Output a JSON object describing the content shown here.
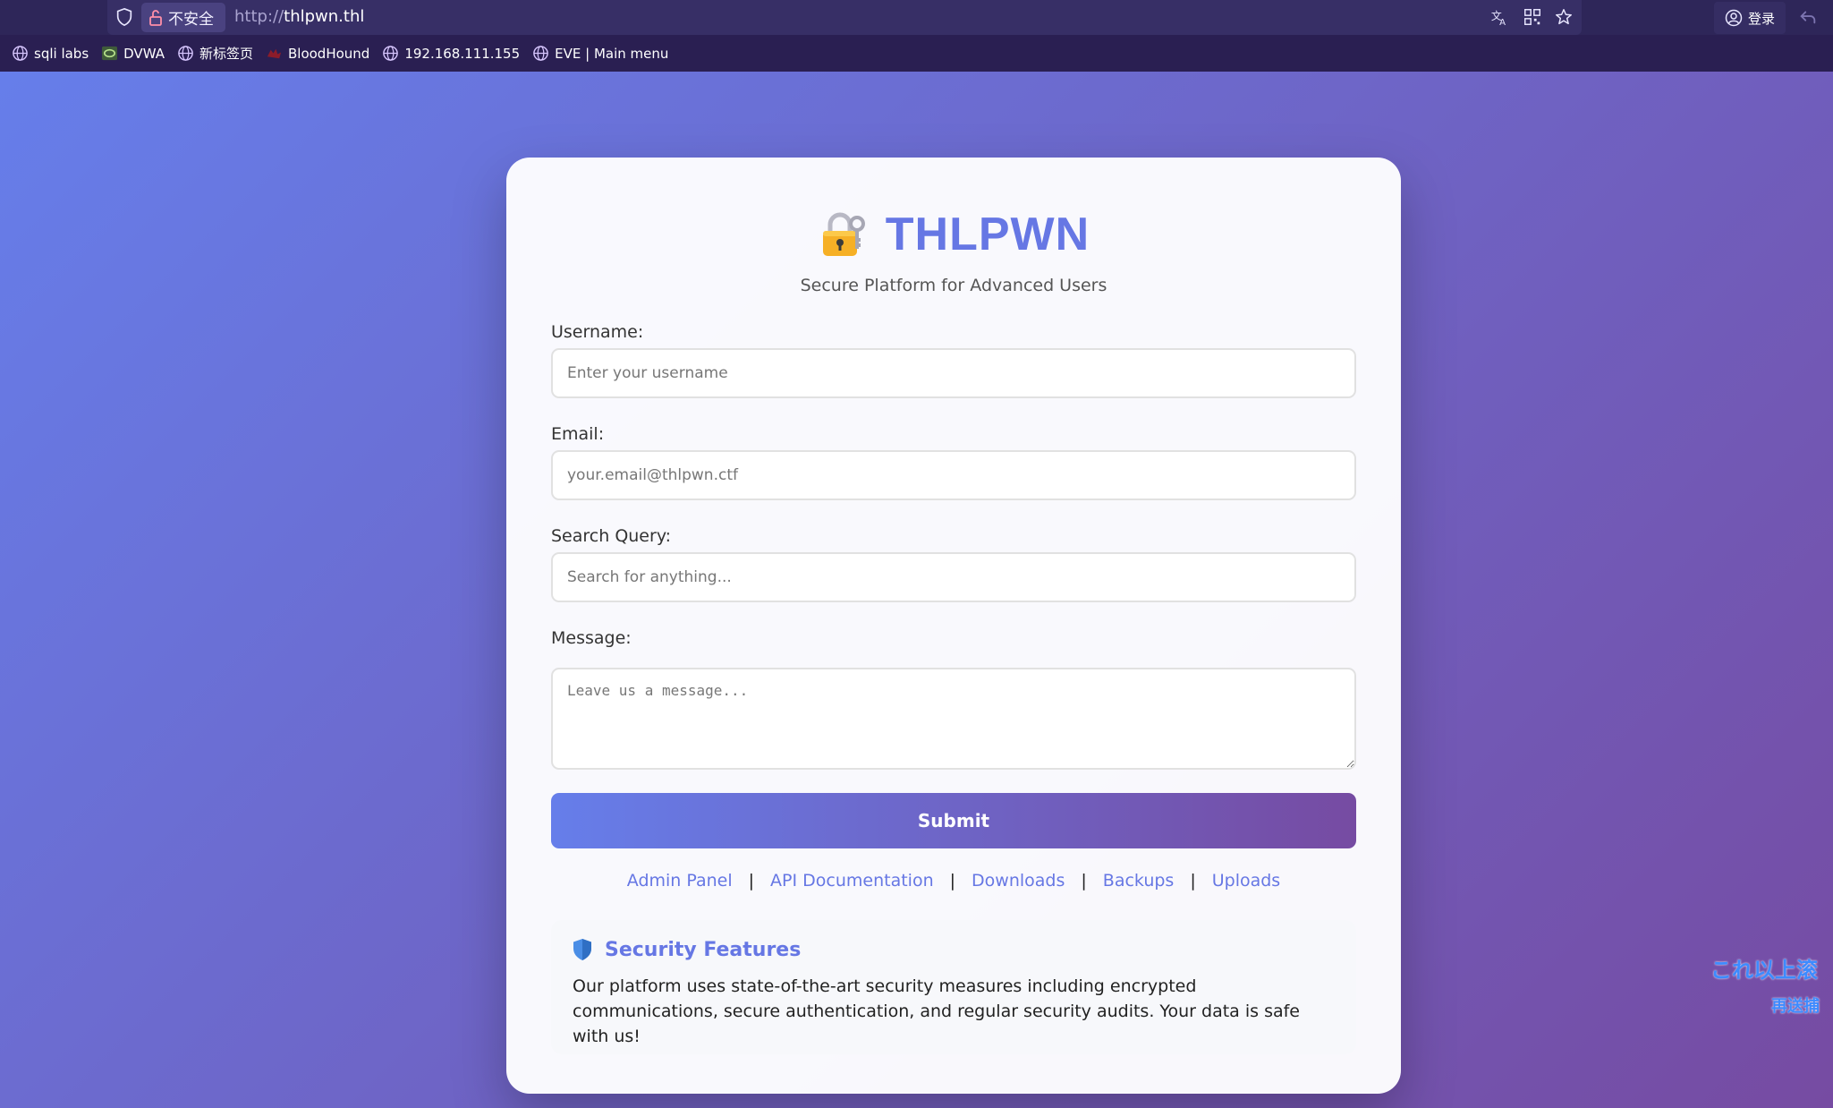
{
  "browser": {
    "insecure_label": "不安全",
    "url_scheme": "http://",
    "url_host": "thlpwn.thl",
    "login_label": "登录",
    "bookmarks": [
      {
        "label": "sqli labs",
        "icon": "globe-icon"
      },
      {
        "label": "DVWA",
        "icon": "dvwa-icon"
      },
      {
        "label": "新标签页",
        "icon": "globe-icon"
      },
      {
        "label": "BloodHound",
        "icon": "bloodhound-icon"
      },
      {
        "label": "192.168.111.155",
        "icon": "globe-icon"
      },
      {
        "label": "EVE | Main menu",
        "icon": "globe-icon"
      }
    ]
  },
  "brand": {
    "title": "THLPWN",
    "subtitle": "Secure Platform for Advanced Users",
    "accent_color": "#6677e4"
  },
  "form": {
    "username_label": "Username:",
    "username_placeholder": "Enter your username",
    "email_label": "Email:",
    "email_placeholder": "your.email@thlpwn.ctf",
    "search_label": "Search Query:",
    "search_placeholder": "Search for anything...",
    "message_label": "Message:",
    "message_placeholder": "Leave us a message...",
    "submit_label": "Submit"
  },
  "links": [
    "Admin Panel",
    "API Documentation",
    "Downloads",
    "Backups",
    "Uploads"
  ],
  "features": {
    "title": "Security Features",
    "body": "Our platform uses state-of-the-art security measures including encrypted communications, secure authentication, and regular security audits. Your data is safe with us!"
  },
  "overlay": {
    "line1": "これ以上滚",
    "line2": "再送捕"
  }
}
